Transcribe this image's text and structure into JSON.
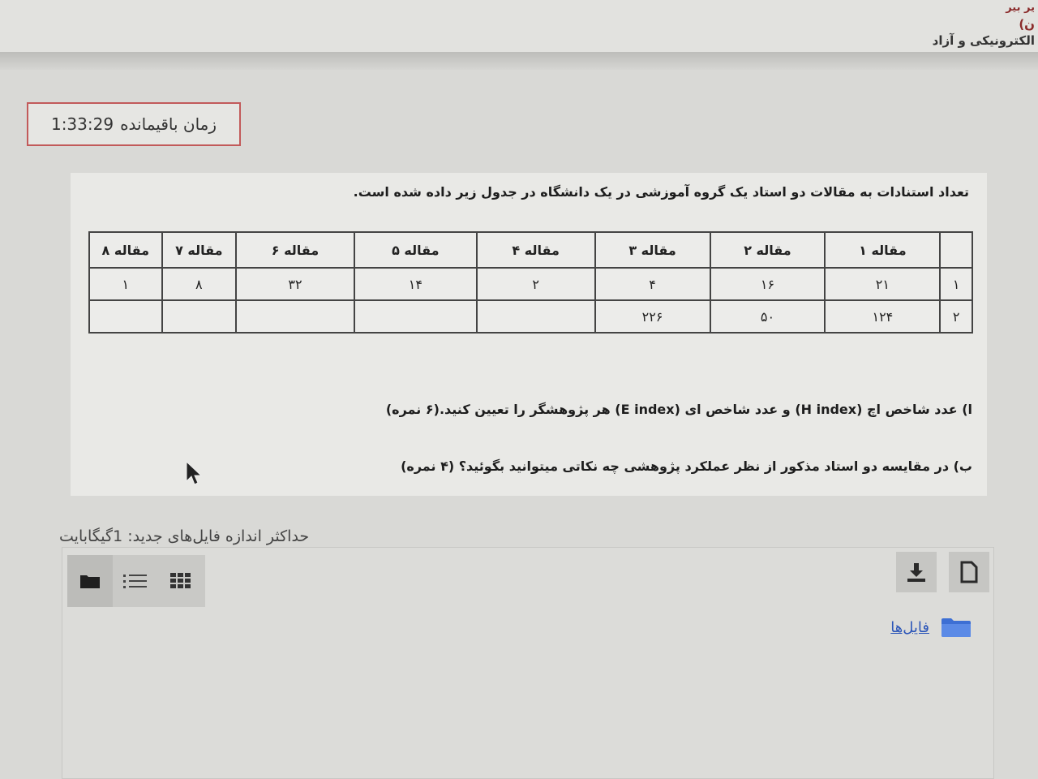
{
  "header": {
    "line1": "یر بیر",
    "line2": "ن)",
    "line3": "الکترونیکی و آزاد"
  },
  "timer": {
    "label": "زمان باقیمانده",
    "value": "1:33:29"
  },
  "question": {
    "intro": "تعداد استنادات به مقالات دو استاد یک گروه آموزشی در یک دانشگاه در جدول زیر داده شده است.",
    "table": {
      "columns": [
        "",
        "مقاله ۱",
        "مقاله ۲",
        "مقاله ۳",
        "مقاله ۴",
        "مقاله ۵",
        "مقاله ۶",
        "مقاله ۷",
        "مقاله ۸"
      ],
      "rows": [
        [
          "۱",
          "۲۱",
          "۱۶",
          "۴",
          "۲",
          "۱۴",
          "۳۲",
          "۸",
          "۱"
        ],
        [
          "۲",
          "۱۲۴",
          "۵۰",
          "۲۲۶",
          "",
          "",
          "",
          "",
          ""
        ]
      ]
    },
    "part_a": "ا) عدد شاخص اچ (H index)  و عدد شاخص ای (E index) هر پژوهشگر را تعیین کنید.(۶ نمره)",
    "part_b": "ب) در مقایسه دو استاد مذکور از نظر عملکرد پژوهشی چه نکاتی میتوانید بگوئید؟  (۴ نمره)"
  },
  "upload": {
    "max_size_label": "حداکثر اندازه فایل‌های جدید: 1گیگابایت",
    "folder_link": "فایل‌ها",
    "icons": {
      "view_folder": "folder-icon",
      "view_list": "list-icon",
      "view_grid": "grid-icon",
      "download": "download-icon",
      "new_file": "file-icon"
    }
  },
  "colors": {
    "timer_border": "#c25a5a",
    "link": "#2b55b8",
    "folder": "#3d6fd4"
  }
}
